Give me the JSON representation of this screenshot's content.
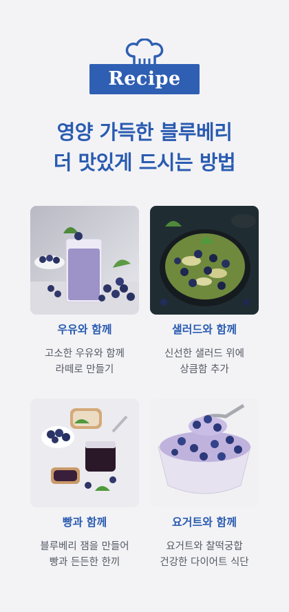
{
  "badge": {
    "label": "Recipe",
    "icon": "chef-hat-icon"
  },
  "headline": {
    "line1": "영양 가득한 블루베리",
    "line2": "더 맛있게 드시는 방법"
  },
  "cards": [
    {
      "title": "우유와 함께",
      "desc1": "고소한 우유와 함께",
      "desc2": "라떼로 만들기",
      "image": "blueberry-milk-latte"
    },
    {
      "title": "샐러드와 함께",
      "desc1": "신선한 샐러드 위에",
      "desc2": "상큼함 추가",
      "image": "blueberry-salad"
    },
    {
      "title": "빵과 함께",
      "desc1": "블루베리 잼을 만들어",
      "desc2": "빵과 든든한 한끼",
      "image": "blueberry-jam-bread"
    },
    {
      "title": "요거트와 함께",
      "desc1": "요거트와 찰떡궁합",
      "desc2": "건강한 다이어트 식단",
      "image": "blueberry-yogurt"
    }
  ],
  "colors": {
    "accent": "#2f5fb3",
    "title": "#2a5bb0",
    "background": "#f3f3f6",
    "body_text": "#555a63"
  }
}
